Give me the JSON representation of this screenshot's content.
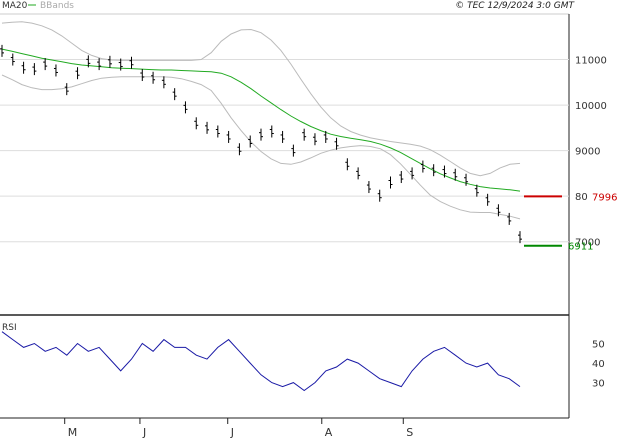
{
  "header": {
    "legend_ma": "MA20",
    "legend_bb": "BBands",
    "copyright": "© TEC 12/9/2024 3:0 GMT"
  },
  "colors": {
    "price": "#000000",
    "ma": "#22aa22",
    "bbands": "#bbbbbb",
    "rsi": "#1a1aa6",
    "resistance": "#cc0000",
    "support": "#008800",
    "grid": "#dddddd"
  },
  "chart_data": {
    "type": "line",
    "price_panel": {
      "ylim": [
        5500,
        12000
      ],
      "yticks": [
        {
          "value": 11000,
          "label": "11000"
        },
        {
          "value": 10000,
          "label": "10000"
        },
        {
          "value": 9000,
          "label": "9000"
        },
        {
          "value": 8000,
          "label": "80"
        },
        {
          "value": 7000,
          "label": "7000"
        }
      ],
      "levels": [
        {
          "name": "resistance",
          "value": 7996,
          "label": "7996"
        },
        {
          "name": "support",
          "value": 6911,
          "label": "6911"
        }
      ],
      "series": [
        {
          "name": "MA20",
          "values": [
            11230,
            11180,
            11130,
            11080,
            11030,
            10990,
            10950,
            10910,
            10880,
            10860,
            10840,
            10820,
            10810,
            10800,
            10790,
            10780,
            10770,
            10770,
            10760,
            10750,
            10740,
            10730,
            10700,
            10620,
            10500,
            10360,
            10200,
            10050,
            9900,
            9760,
            9640,
            9530,
            9440,
            9360,
            9310,
            9270,
            9240,
            9200,
            9140,
            9060,
            8960,
            8840,
            8720,
            8600,
            8490,
            8400,
            8320,
            8260,
            8210,
            8180,
            8160,
            8140,
            8110
          ]
        },
        {
          "name": "BBands upper",
          "values": [
            11800,
            11820,
            11830,
            11800,
            11740,
            11650,
            11520,
            11360,
            11200,
            11090,
            11020,
            10990,
            10980,
            10980,
            10980,
            10980,
            10980,
            10980,
            10980,
            10980,
            11000,
            11150,
            11400,
            11560,
            11650,
            11660,
            11590,
            11430,
            11200,
            10900,
            10570,
            10250,
            9960,
            9720,
            9540,
            9420,
            9340,
            9280,
            9240,
            9200,
            9170,
            9140,
            9100,
            9020,
            8900,
            8760,
            8620,
            8500,
            8450,
            8500,
            8620,
            8700,
            8720
          ]
        },
        {
          "name": "BBands lower",
          "values": [
            10660,
            10560,
            10450,
            10380,
            10340,
            10340,
            10360,
            10400,
            10470,
            10540,
            10590,
            10610,
            10620,
            10620,
            10620,
            10620,
            10620,
            10610,
            10580,
            10520,
            10450,
            10320,
            10040,
            9720,
            9440,
            9190,
            8980,
            8820,
            8720,
            8700,
            8750,
            8840,
            8940,
            9010,
            9060,
            9090,
            9110,
            9090,
            9040,
            8910,
            8710,
            8480,
            8240,
            8020,
            7880,
            7780,
            7700,
            7650,
            7640,
            7640,
            7600,
            7560,
            7500
          ]
        },
        {
          "name": "Price",
          "values": [
            11190,
            11000,
            10820,
            10790,
            10900,
            10760,
            10350,
            10700,
            10960,
            10900,
            10950,
            10890,
            10930,
            10660,
            10600,
            10500,
            10240,
            9950,
            9600,
            9500,
            9420,
            9300,
            9030,
            9200,
            9350,
            9420,
            9300,
            9000,
            9350,
            9250,
            9300,
            9150,
            8700,
            8500,
            8200,
            8010,
            8300,
            8420,
            8500,
            8650,
            8570,
            8540,
            8470,
            8360,
            8120,
            7920,
            7690,
            7500,
            7100
          ]
        }
      ]
    },
    "rsi_panel": {
      "ylim": [
        15,
        62
      ],
      "yticks": [
        {
          "value": 50,
          "label": "50"
        },
        {
          "value": 40,
          "label": "40"
        },
        {
          "value": 30,
          "label": "30"
        }
      ],
      "series": [
        {
          "name": "RSI",
          "values": [
            56,
            52,
            48,
            50,
            46,
            48,
            44,
            50,
            46,
            48,
            42,
            36,
            42,
            50,
            46,
            52,
            48,
            48,
            44,
            42,
            48,
            52,
            46,
            40,
            34,
            30,
            28,
            30,
            26,
            30,
            36,
            38,
            42,
            40,
            36,
            32,
            30,
            28,
            36,
            42,
            46,
            48,
            44,
            40,
            38,
            40,
            34,
            32,
            28
          ]
        }
      ]
    },
    "x_axis": {
      "categories": [
        "M",
        "J",
        "J",
        "A",
        "S"
      ],
      "positions": [
        10,
        22,
        36,
        51,
        64
      ]
    }
  }
}
